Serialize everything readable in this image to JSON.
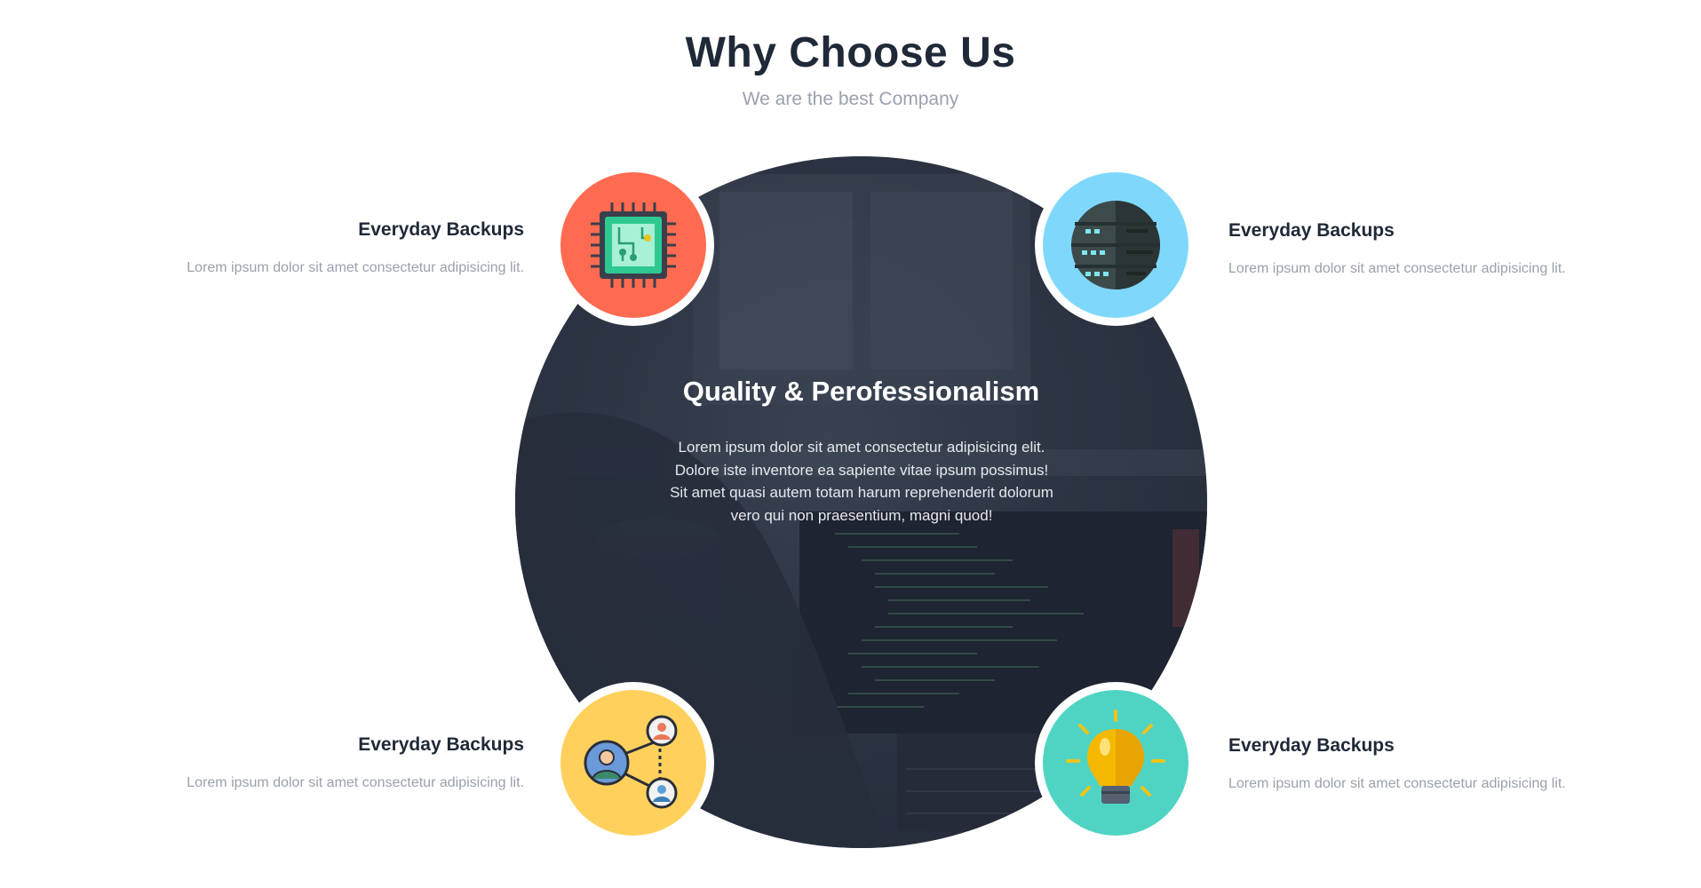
{
  "header": {
    "title": "Why Choose Us",
    "subtitle": "We are the best Company"
  },
  "center": {
    "title": "Quality & Perofessionalism",
    "text": "Lorem ipsum dolor sit amet consectetur adipisicing elit. Dolore iste inventore ea sapiente vitae ipsum possimus! Sit amet quasi autem totam harum reprehenderit dolorum vero qui non praesentium, magni quod!"
  },
  "features": [
    {
      "title": "Everyday Backups",
      "text": "Lorem ipsum dolor sit amet consectetur adipisicing lit.",
      "icon": "chip-icon",
      "color": "#ff6b50"
    },
    {
      "title": "Everyday Backups",
      "text": "Lorem ipsum dolor sit amet consectetur adipisicing lit.",
      "icon": "server-globe-icon",
      "color": "#7fd8fb"
    },
    {
      "title": "Everyday Backups",
      "text": "Lorem ipsum dolor sit amet consectetur adipisicing lit.",
      "icon": "network-people-icon",
      "color": "#ffd15c"
    },
    {
      "title": "Everyday Backups",
      "text": "Lorem ipsum dolor sit amet consectetur adipisicing lit.",
      "icon": "lightbulb-icon",
      "color": "#4fd4c4"
    }
  ]
}
